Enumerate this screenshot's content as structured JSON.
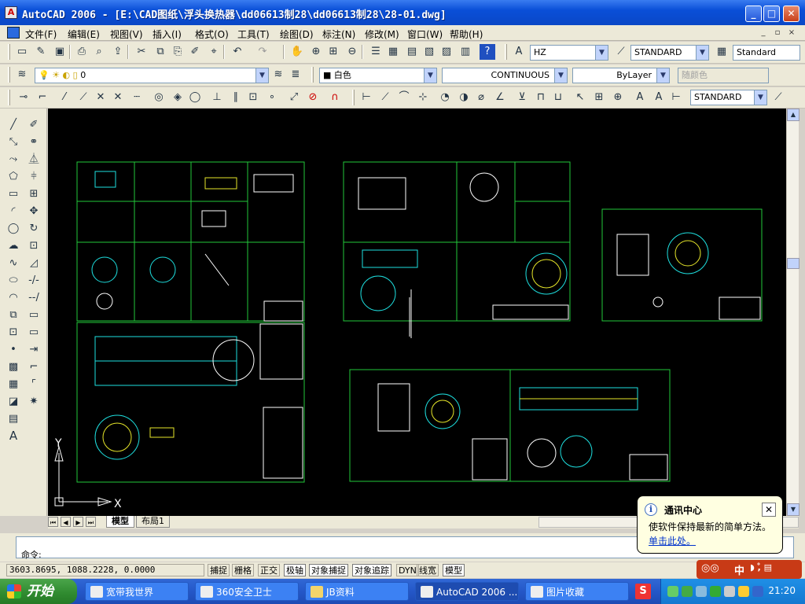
{
  "window": {
    "title": "AutoCAD 2006 - [E:\\CAD图纸\\浮头换热器\\dd06613制28\\dd06613制28\\28-01.dwg]",
    "app_icon": "A",
    "controls": [
      "_",
      "□",
      "✕"
    ]
  },
  "menu": {
    "items": [
      "文件(F)",
      "编辑(E)",
      "视图(V)",
      "插入(I)",
      "格式(O)",
      "工具(T)",
      "绘图(D)",
      "标注(N)",
      "修改(M)",
      "窗口(W)",
      "帮助(H)"
    ],
    "mdi_controls": [
      "_",
      "▫",
      "×"
    ]
  },
  "toolbars": {
    "text_style": "HZ",
    "dim_style": "STANDARD",
    "table_style": "Standard",
    "layer": "0",
    "color": "白色",
    "linetype": "CONTINUOUS",
    "lineweight": "ByLayer",
    "plot_style": "随颜色",
    "dim_style_2": "STANDARD"
  },
  "canvas": {
    "background": "#000000",
    "ucs_y_label": "Y",
    "ucs_x_label": "X",
    "sheet_color": "#22c83a",
    "accent_cyan": "#1ee0e0",
    "accent_yellow": "#e6e62a"
  },
  "tabs": {
    "model": "模型",
    "layout": "布局1"
  },
  "command": {
    "prompt": "命令:"
  },
  "status": {
    "coordinates": "3603.8695, 1088.2228, 0.0000",
    "buttons": [
      {
        "label": "捕捉",
        "on": false
      },
      {
        "label": "栅格",
        "on": false
      },
      {
        "label": "正交",
        "on": false
      },
      {
        "label": "极轴",
        "on": true
      },
      {
        "label": "对象捕捉",
        "on": true
      },
      {
        "label": "对象追踪",
        "on": true
      },
      {
        "label": "DYN",
        "on": false
      },
      {
        "label": "线宽",
        "on": false
      },
      {
        "label": "模型",
        "on": true
      }
    ]
  },
  "balloon": {
    "title": "通讯中心",
    "text": "使软件保持最新的简单方法。",
    "link": "单击此处。"
  },
  "taskbar": {
    "start": "开始",
    "tasks": [
      "宽带我世界",
      "360安全卫士",
      "JB资料",
      "AutoCAD 2006 ...",
      "图片收藏"
    ],
    "clock": "21:20",
    "ime": "中"
  }
}
